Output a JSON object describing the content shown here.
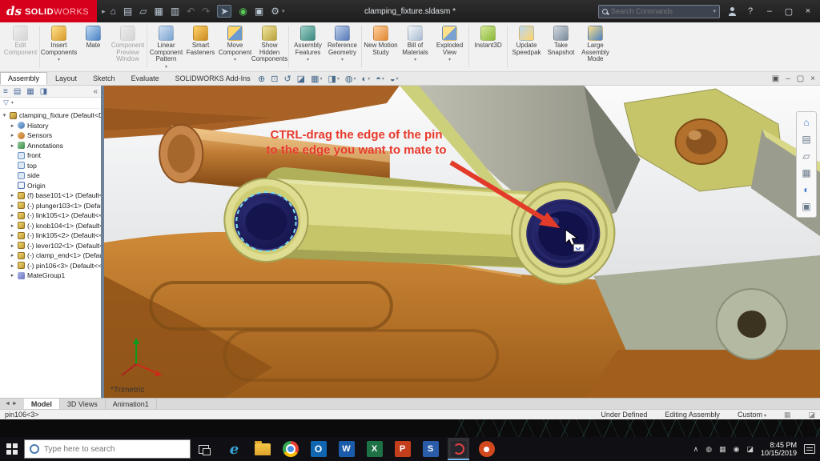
{
  "titlebar": {
    "logo_mark": "ds",
    "logo_solid": "SOLID",
    "logo_works": "WORKS",
    "doc_title": "clamping_fixture.sldasm *",
    "search_placeholder": "Search Commands",
    "help": "?",
    "minimize": "–",
    "restore": "▢",
    "close": "×"
  },
  "icons": {
    "flyout_right": "▸",
    "dropdown": "▾",
    "expand": "▸",
    "collapse": "▾",
    "panel_collapse": "«",
    "filter_funnel": "▽"
  },
  "qat": {
    "items": [
      {
        "name": "home",
        "glyph": "⌂"
      },
      {
        "name": "new-document",
        "glyph": "▤"
      },
      {
        "name": "open",
        "glyph": "▱"
      },
      {
        "name": "save",
        "glyph": "▦"
      },
      {
        "name": "print",
        "glyph": "▥"
      },
      {
        "name": "undo",
        "glyph": "↶"
      },
      {
        "name": "redo",
        "glyph": "↷"
      },
      {
        "name": "select",
        "glyph": "➤"
      },
      {
        "name": "rebuild",
        "glyph": "◉"
      },
      {
        "name": "file-properties",
        "glyph": "▣"
      },
      {
        "name": "options",
        "glyph": "⚙"
      }
    ]
  },
  "ribbon": {
    "buttons": [
      {
        "label": "Edit Component",
        "icon": "edit-component",
        "enabled": false
      },
      {
        "label": "Insert Components",
        "icon": "insert-components",
        "enabled": true
      },
      {
        "label": "Mate",
        "icon": "mate",
        "enabled": true
      },
      {
        "label": "Component Preview Window",
        "icon": "component-preview",
        "enabled": false
      },
      {
        "label": "Linear Component Pattern",
        "icon": "linear-pattern",
        "enabled": true
      },
      {
        "label": "Smart Fasteners",
        "icon": "smart-fasteners",
        "enabled": true
      },
      {
        "label": "Move Component",
        "icon": "move-component",
        "enabled": true
      },
      {
        "label": "Show Hidden Components",
        "icon": "show-hidden",
        "enabled": true
      },
      {
        "label": "Assembly Features",
        "icon": "assembly-features",
        "enabled": true
      },
      {
        "label": "Reference Geometry",
        "icon": "reference-geometry",
        "enabled": true
      },
      {
        "label": "New Motion Study",
        "icon": "motion-study",
        "enabled": true
      },
      {
        "label": "Bill of Materials",
        "icon": "bom",
        "enabled": true
      },
      {
        "label": "Exploded View",
        "icon": "exploded-view",
        "enabled": true
      },
      {
        "label": "Instant3D",
        "icon": "instant3d",
        "enabled": true
      },
      {
        "label": "Update Speedpak",
        "icon": "speedpak",
        "enabled": true
      },
      {
        "label": "Take Snapshot",
        "icon": "snapshot",
        "enabled": true
      },
      {
        "label": "Large Assembly Mode",
        "icon": "large-assembly",
        "enabled": true
      }
    ]
  },
  "tabs": {
    "items": [
      {
        "label": "Assembly",
        "active": true
      },
      {
        "label": "Layout",
        "active": false
      },
      {
        "label": "Sketch",
        "active": false
      },
      {
        "label": "Evaluate",
        "active": false
      },
      {
        "label": "SOLIDWORKS Add-Ins",
        "active": false
      }
    ]
  },
  "headsup": {
    "items": [
      {
        "name": "zoom-fit",
        "glyph": "⊕"
      },
      {
        "name": "zoom-area",
        "glyph": "⊡"
      },
      {
        "name": "previous-view",
        "glyph": "↺"
      },
      {
        "name": "section-view",
        "glyph": "◪"
      },
      {
        "name": "view-orientation",
        "glyph": "▦"
      },
      {
        "name": "display-style",
        "glyph": "◨"
      },
      {
        "name": "hide-show-items",
        "glyph": "◍"
      },
      {
        "name": "edit-appearance",
        "glyph": "◐"
      },
      {
        "name": "apply-scene",
        "glyph": "◓"
      },
      {
        "name": "view-settings",
        "glyph": "◒"
      }
    ]
  },
  "docwin": {
    "items": [
      {
        "name": "restore-group",
        "glyph": "▣"
      },
      {
        "name": "minimize-doc",
        "glyph": "–"
      },
      {
        "name": "restore-doc",
        "glyph": "▢"
      },
      {
        "name": "close-doc",
        "glyph": "×"
      }
    ]
  },
  "panel": {
    "tabs": [
      {
        "name": "featuremanager-tree",
        "glyph": "≡"
      },
      {
        "name": "propertymanager",
        "glyph": "▤"
      },
      {
        "name": "configurationmanager",
        "glyph": "▦"
      },
      {
        "name": "displaymanager",
        "glyph": "◨"
      }
    ]
  },
  "tree": {
    "items": [
      {
        "label": "clamping_fixture (Default<Dis",
        "icon": "assembly-icon"
      },
      {
        "label": "History",
        "icon": "history-icon"
      },
      {
        "label": "Sensors",
        "icon": "sensors-icon"
      },
      {
        "label": "Annotations",
        "icon": "annotations-icon"
      },
      {
        "label": "front",
        "icon": "plane-icon"
      },
      {
        "label": "top",
        "icon": "plane-icon"
      },
      {
        "label": "side",
        "icon": "plane-icon"
      },
      {
        "label": "Origin",
        "icon": "origin-icon"
      },
      {
        "label": "(f) base101<1> (Default<<",
        "icon": "part-icon"
      },
      {
        "label": "(-) plunger103<1> (Defaul",
        "icon": "part-icon"
      },
      {
        "label": "(-) link105<1> (Default<<[",
        "icon": "part-icon"
      },
      {
        "label": "(-) knob104<1> (Default<<",
        "icon": "part-icon"
      },
      {
        "label": "(-) link105<2> (Default<<[",
        "icon": "part-icon"
      },
      {
        "label": "(-) lever102<1> (Default<<",
        "icon": "part-icon"
      },
      {
        "label": "(-) clamp_end<1> (Default",
        "icon": "part-icon"
      },
      {
        "label": "(-) pin106<3> (Default<<",
        "icon": "part-icon"
      },
      {
        "label": "MateGroup1",
        "icon": "mategroup-icon"
      }
    ]
  },
  "viewport": {
    "annotation_line1": "CTRL-drag the edge of the pin",
    "annotation_line2": "to the edge you want to mate to",
    "view_orientation": "*Trimetric"
  },
  "taskpane": {
    "items": [
      {
        "name": "solidworks-resources",
        "glyph": "⌂"
      },
      {
        "name": "design-library",
        "glyph": "▤"
      },
      {
        "name": "file-explorer",
        "glyph": "▱"
      },
      {
        "name": "view-palette",
        "glyph": "▦"
      },
      {
        "name": "appearances-scenes",
        "glyph": "◐"
      },
      {
        "name": "custom-properties",
        "glyph": "▣"
      }
    ]
  },
  "bottom_tabs": {
    "nav_prev": "◄",
    "nav_next": "►",
    "items": [
      {
        "label": "Model",
        "active": true
      },
      {
        "label": "3D Views",
        "active": false
      },
      {
        "label": "Animation1",
        "active": false
      }
    ]
  },
  "statusbar": {
    "selection": "pin106<3>",
    "state": "Under Defined",
    "mode": "Editing Assembly",
    "config": "Custom"
  },
  "taskbar": {
    "search_placeholder": "Type here to search",
    "apps": [
      "edge",
      "file-explorer",
      "chrome",
      "outlook",
      "word",
      "excel",
      "powerpoint",
      "snagit",
      "solidworks",
      "camtasia"
    ],
    "active_app": "solidworks",
    "time": "8:45 PM",
    "date": "10/15/2019"
  }
}
